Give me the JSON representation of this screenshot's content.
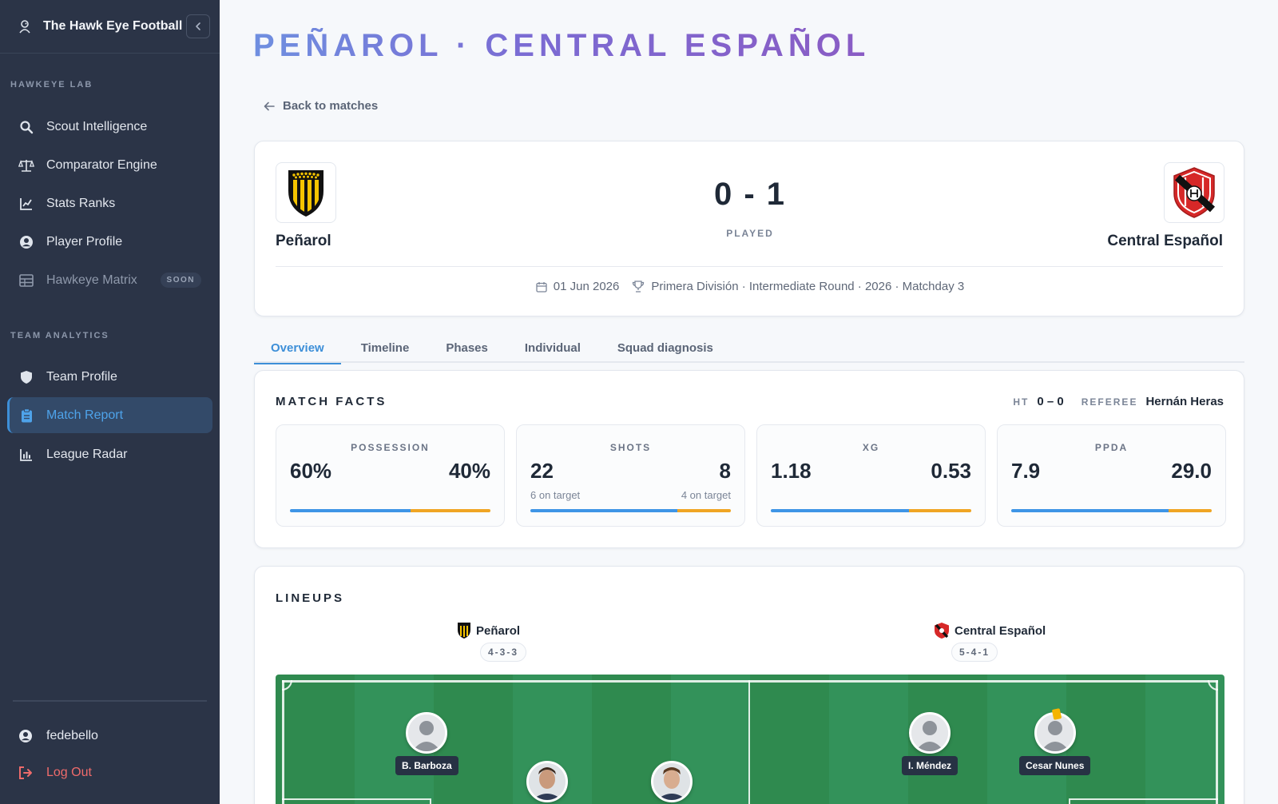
{
  "app": {
    "title": "The Hawk Eye Football"
  },
  "sidebar": {
    "sections": [
      {
        "label": "HAWKEYE LAB"
      },
      {
        "label": "TEAM ANALYTICS"
      }
    ],
    "items": [
      {
        "label": "Scout Intelligence",
        "icon": "search-icon"
      },
      {
        "label": "Comparator Engine",
        "icon": "scale-icon"
      },
      {
        "label": "Stats Ranks",
        "icon": "line-chart-icon"
      },
      {
        "label": "Player Profile",
        "icon": "user-circle-icon"
      },
      {
        "label": "Hawkeye Matrix",
        "icon": "grid-icon",
        "badge": "SOON",
        "disabled": true
      },
      {
        "label": "Team Profile",
        "icon": "shield-icon"
      },
      {
        "label": "Match Report",
        "icon": "clipboard-icon",
        "active": true
      },
      {
        "label": "League Radar",
        "icon": "bar-chart-icon"
      }
    ],
    "user": {
      "name": "fedebello",
      "logout": "Log Out"
    }
  },
  "page": {
    "title": "PEÑAROL · CENTRAL ESPAÑOL",
    "back_label": "Back to matches"
  },
  "match": {
    "home": {
      "name": "Peñarol",
      "color": "#f5c400"
    },
    "away": {
      "name": "Central Español",
      "color": "#d62828"
    },
    "score": "0 - 1",
    "status": "PLAYED",
    "date": "01 Jun 2026",
    "competition": "Primera División · Intermediate Round · 2026 · Matchday 3"
  },
  "tabs": [
    {
      "label": "Overview",
      "active": true
    },
    {
      "label": "Timeline"
    },
    {
      "label": "Phases"
    },
    {
      "label": "Individual"
    },
    {
      "label": "Squad diagnosis"
    }
  ],
  "facts": {
    "heading": "MATCH FACTS",
    "ht_label": "HT",
    "ht_value": "0 – 0",
    "referee_label": "REFEREE",
    "referee_value": "Hernán Heras",
    "stats": [
      {
        "title": "POSSESSION",
        "home": "60%",
        "away": "40%",
        "home_share": 0.6
      },
      {
        "title": "SHOTS",
        "home": "22",
        "away": "8",
        "home_sub": "6 on target",
        "away_sub": "4 on target",
        "home_share": 0.733
      },
      {
        "title": "XG",
        "home": "1.18",
        "away": "0.53",
        "home_share": 0.69
      },
      {
        "title": "PPDA",
        "home": "7.9",
        "away": "29.0",
        "home_share": 0.785
      }
    ],
    "colors": {
      "home": "#3e95e6",
      "away": "#f0a524"
    }
  },
  "lineups": {
    "heading": "LINEUPS",
    "home": {
      "name": "Peñarol",
      "formation": "4-3-3"
    },
    "away": {
      "name": "Central Español",
      "formation": "5-4-1"
    },
    "players": [
      {
        "name": "B. Barboza",
        "side": "home"
      },
      {
        "name": "",
        "side": "home"
      },
      {
        "name": "",
        "side": "home"
      },
      {
        "name": "I. Méndez",
        "side": "away"
      },
      {
        "name": "Cesar Nunes",
        "side": "away",
        "yellow_card": true
      }
    ]
  }
}
